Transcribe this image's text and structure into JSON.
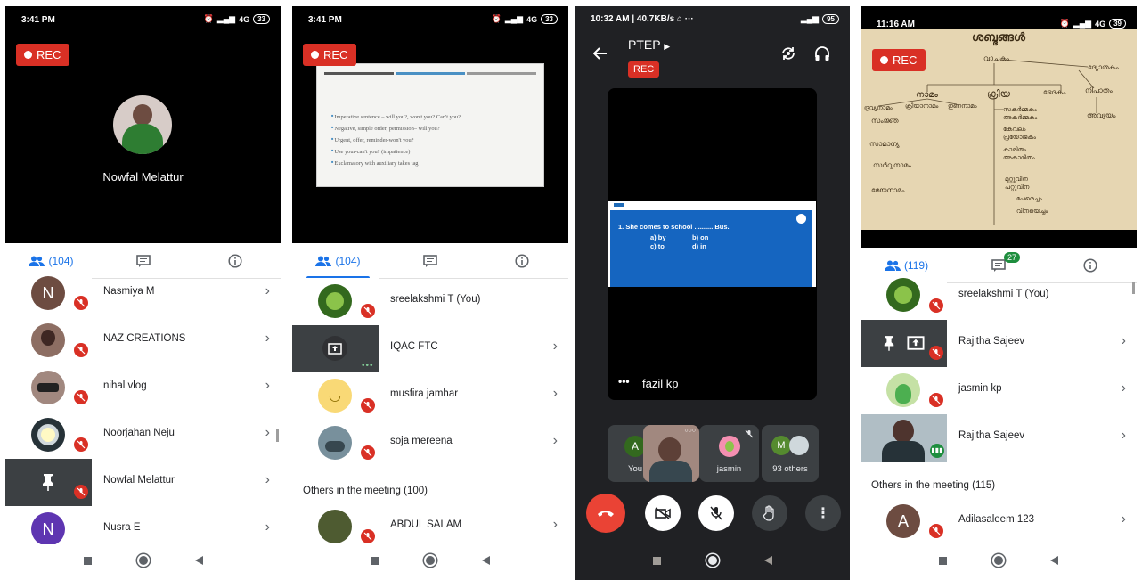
{
  "panel1": {
    "status": {
      "time": "3:41 PM",
      "network": "4G",
      "battery": "33"
    },
    "rec_label": "REC",
    "speaker_name": "Nowfal Melattur",
    "tabs": {
      "people_count": "(104)"
    },
    "participants": [
      {
        "name": "Nasmiya M",
        "initial": "N",
        "color": "#6d4c41"
      },
      {
        "name": "NAZ CREATIONS",
        "initial": "",
        "color": "#8d6e63"
      },
      {
        "name": "nihal vlog",
        "initial": "",
        "color": "#5d4037"
      },
      {
        "name": "Noorjahan Neju",
        "initial": "",
        "color": "#37474f"
      },
      {
        "name": "Nowfal Melattur",
        "initial": "",
        "color": "#3c4043"
      },
      {
        "name": "Nusra E",
        "initial": "N",
        "color": "#5e35b1"
      }
    ]
  },
  "panel2": {
    "status": {
      "time": "3:41 PM",
      "network": "4G",
      "battery": "33"
    },
    "rec_label": "REC",
    "slide_bullets": [
      "Imperative sentence – will you?, won't you? Can't you?",
      "Negative, simple order, permission– will you?",
      "Urgent, offer, reminder-won't you?",
      "Use your-can't you? (impatience)",
      "Exclamatory with auxiliary takes tag"
    ],
    "tabs": {
      "people_count": "(104)"
    },
    "participants": [
      {
        "name": "sreelakshmi T (You)"
      },
      {
        "name": "IQAC FTC"
      },
      {
        "name": "musfira jamhar"
      },
      {
        "name": "soja mereena"
      }
    ],
    "others_heading": "Others in the meeting (100)",
    "others": [
      {
        "name": "ABDUL SALAM"
      }
    ]
  },
  "panel3": {
    "status": {
      "time": "10:32 AM",
      "speed": "40.7KB/s",
      "battery": "95"
    },
    "meeting_title": "PTEP",
    "rec_label": "REC",
    "quiz": {
      "question": "1.   She comes to school .......... Bus.",
      "options": [
        "a) by",
        "b) on",
        "c) to",
        "d) in"
      ]
    },
    "presenter": "fazil kp",
    "tiles": [
      {
        "label": "You",
        "initial": "A",
        "color": "#33691e"
      },
      {
        "label": ""
      },
      {
        "label": "jasmin"
      },
      {
        "label": "93 others",
        "initial": "M",
        "color": "#558b2f"
      }
    ]
  },
  "panel4": {
    "status": {
      "time": "11:16 AM",
      "network": "4G",
      "battery": "39"
    },
    "rec_label": "REC",
    "board_title": "ശബ്ദങ്ങൾ",
    "board_words": [
      "വാചകം",
      "ദ്യോതകം",
      "നാമം",
      "ക്രിയ",
      "ഭേദകം",
      "നിപാതം",
      "ദ്രവ്യനാമം",
      "ക്രിയാനാമം",
      "ഗുണനാമം",
      "സകർമ്മകം",
      "അകർമ്മകം",
      "അവ്യയം",
      "സംജ്ഞ",
      "കേവലം",
      "പ്രയോജകം",
      "സാമാന്യ",
      "കാരിതം",
      "അകാരിതം",
      "സർവ്വനാമം",
      "മുറ്റുവിന",
      "പറ്റുവിന",
      "മേയനാമം",
      "പേരെച്ചം",
      "വിനയെച്ചം"
    ],
    "tabs": {
      "people_count": "(119)",
      "chat_badge": "27"
    },
    "participants": [
      {
        "name": "sreelakshmi T (You)"
      },
      {
        "name": "Rajitha Sajeev"
      },
      {
        "name": "jasmin kp"
      },
      {
        "name": "Rajitha Sajeev"
      }
    ],
    "others_heading": "Others in the meeting (115)",
    "others": [
      {
        "name": "Adilasaleem 123",
        "initial": "A",
        "color": "#6d4c41"
      }
    ]
  },
  "icons": {
    "people": "people-icon",
    "chat": "chat-icon",
    "info": "info-icon",
    "mic_off": "mic-off-icon",
    "chevron": "chevron-right-icon",
    "back": "back-arrow-icon",
    "camera_flip": "camera-flip-icon",
    "audio": "headphones-icon",
    "end_call": "end-call-icon",
    "camera_off": "camera-off-icon",
    "hand": "raise-hand-icon",
    "more": "more-vert-icon",
    "pin": "pin-icon",
    "present": "present-screen-icon"
  },
  "colors": {
    "accent": "#1a73e8",
    "rec": "#d93025",
    "end_call": "#ea4335",
    "meet_dark": "#202124"
  }
}
